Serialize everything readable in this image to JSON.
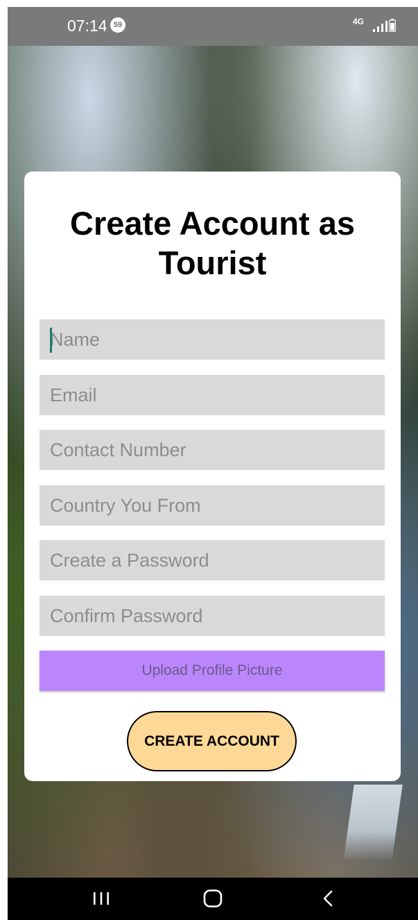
{
  "status_bar": {
    "time": "07:14",
    "notification_count": "59",
    "network": "4G",
    "signal_icon": "signal-bars-icon",
    "battery_icon": "battery-icon"
  },
  "form": {
    "title": "Create Account as Tourist",
    "fields": {
      "name": {
        "placeholder": "Name",
        "value": ""
      },
      "email": {
        "placeholder": "Email",
        "value": ""
      },
      "contact": {
        "placeholder": "Contact Number",
        "value": ""
      },
      "country": {
        "placeholder": "Country You From",
        "value": ""
      },
      "password": {
        "placeholder": "Create a Password",
        "value": ""
      },
      "confirm_password": {
        "placeholder": "Confirm Password",
        "value": ""
      }
    },
    "upload_label": "Upload Profile Picture",
    "submit_label": "CREATE ACCOUNT"
  },
  "nav_bar": {
    "recents_icon": "recent-apps-icon",
    "home_icon": "home-icon",
    "back_icon": "back-icon"
  },
  "colors": {
    "field_background": "#d9d9d9",
    "upload_button": "#bb86fc",
    "submit_button": "#fed896",
    "status_bar": "#7a7a7a",
    "caret": "#1f7a6e"
  }
}
